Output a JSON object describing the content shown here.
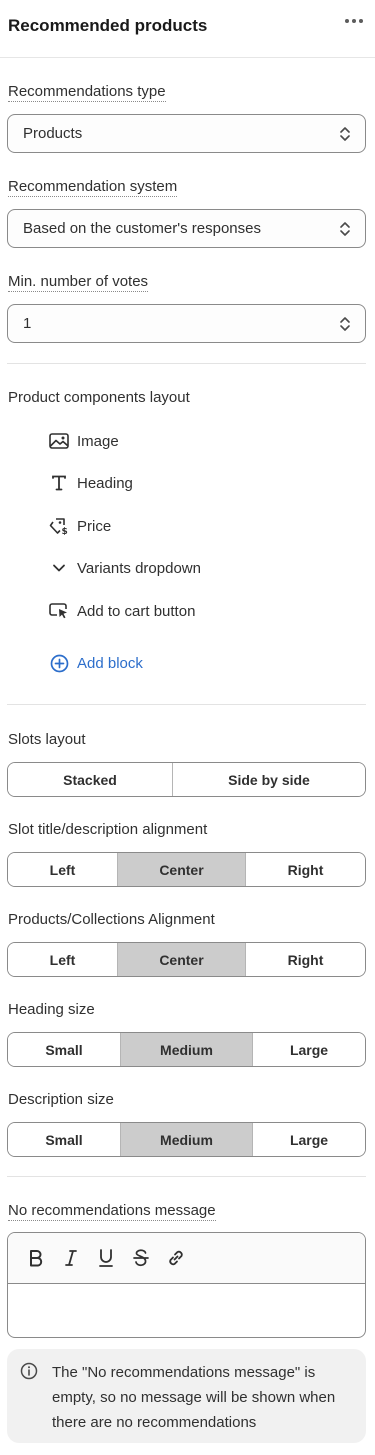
{
  "header": {
    "title": "Recommended products"
  },
  "fields": {
    "recommendations_type": {
      "label": "Recommendations type",
      "value": "Products"
    },
    "recommendation_system": {
      "label": "Recommendation system",
      "value": "Based on the customer's responses"
    },
    "min_votes": {
      "label": "Min. number of votes",
      "value": "1"
    }
  },
  "components": {
    "label": "Product components layout",
    "items": [
      {
        "label": "Image",
        "icon": "image-icon"
      },
      {
        "label": "Heading",
        "icon": "text-icon"
      },
      {
        "label": "Price",
        "icon": "price-tag-icon"
      },
      {
        "label": "Variants dropdown",
        "icon": "chevron-down-icon"
      },
      {
        "label": "Add to cart button",
        "icon": "cursor-button-icon"
      }
    ],
    "add_block": "Add block"
  },
  "slots_layout": {
    "label": "Slots layout",
    "options": [
      "Stacked",
      "Side by side"
    ],
    "selected": ""
  },
  "slot_alignment": {
    "label": "Slot title/description alignment",
    "options": [
      "Left",
      "Center",
      "Right"
    ],
    "selected": "Center"
  },
  "products_alignment": {
    "label": "Products/Collections Alignment",
    "options": [
      "Left",
      "Center",
      "Right"
    ],
    "selected": "Center"
  },
  "heading_size": {
    "label": "Heading size",
    "options": [
      "Small",
      "Medium",
      "Large"
    ],
    "selected": "Medium"
  },
  "description_size": {
    "label": "Description size",
    "options": [
      "Small",
      "Medium",
      "Large"
    ],
    "selected": "Medium"
  },
  "no_recs": {
    "label": "No recommendations message",
    "toolbar": [
      "bold",
      "italic",
      "underline",
      "strikethrough",
      "link"
    ],
    "value": ""
  },
  "notice": "The \"No recommendations message\" is empty, so no message will be shown when there are no recommendations",
  "colors": {
    "accent": "#2c6ecb",
    "selected_segment": "#cccccc",
    "border": "#8a8a8a"
  }
}
